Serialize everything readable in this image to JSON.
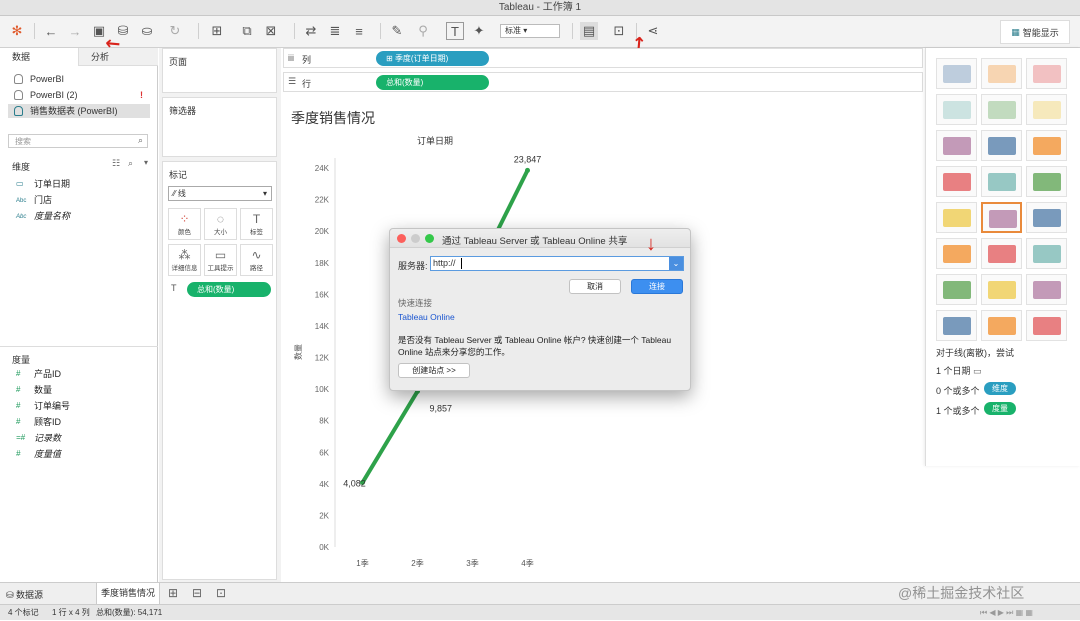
{
  "window": {
    "title": "Tableau - 工作簿 1"
  },
  "toolbar": {
    "mark_size_select": "标准",
    "smart_show_label": "智能显示"
  },
  "left_pane": {
    "tabs": [
      "数据",
      "分析"
    ],
    "datasources": [
      "PowerBI",
      "PowerBI (2)",
      "销售数据表 (PowerBI)"
    ],
    "search_placeholder": "搜索",
    "dimensions_title": "维度",
    "dimensions": [
      {
        "icon": "calendar-icon",
        "label": "订单日期"
      },
      {
        "icon": "Abc",
        "label": "门店"
      },
      {
        "icon": "Abc",
        "label": "度量名称"
      }
    ],
    "measures_title": "度量",
    "measures": [
      "产品ID",
      "数量",
      "订单编号",
      "顾客ID",
      "记录数",
      "度量值"
    ]
  },
  "cards": {
    "pages": "页面",
    "filters": "筛选器",
    "marks": "标记",
    "mark_type": "线",
    "mark_buttons": [
      "颜色",
      "大小",
      "标签",
      "详细信息",
      "工具提示",
      "路径"
    ],
    "mark_pill": "总和(数量)"
  },
  "shelves": {
    "columns_label": "列",
    "columns_pill": "季度(订单日期)",
    "rows_label": "行",
    "rows_pill": "总和(数量)"
  },
  "view": {
    "title": "季度销售情况"
  },
  "chart_data": {
    "type": "line",
    "title": "订单日期",
    "categories": [
      "1季",
      "2季",
      "3季",
      "4季"
    ],
    "values": [
      4082,
      9857,
      null,
      23847
    ],
    "labels": [
      "4,082",
      "9,857",
      "",
      "23,847"
    ],
    "ylabel": "数量",
    "yticks": [
      "0K",
      "2K",
      "4K",
      "6K",
      "8K",
      "10K",
      "12K",
      "14K",
      "16K",
      "18K",
      "20K",
      "22K",
      "24K"
    ],
    "ylim": [
      0,
      24000
    ],
    "color": "#2ea24a"
  },
  "dialog": {
    "title": "通过 Tableau Server 或 Tableau Online 共享",
    "server_label": "服务器:",
    "server_value": "http://",
    "cancel": "取消",
    "connect": "连接",
    "quick_title": "快速连接",
    "quick_link": "Tableau Online",
    "note": "是否没有 Tableau Server 或 Tableau Online 帐户? 快速创建一个 Tableau Online 站点来分享您的工作。",
    "create_site": "创建站点 >>"
  },
  "show_me": {
    "hint_title": "对于线(离散)，尝试",
    "hints": [
      {
        "text": "1 个日期",
        "pill": ""
      },
      {
        "text": "0 个或多个",
        "pill": "维度"
      },
      {
        "text": "1 个或多个",
        "pill": "度量"
      }
    ]
  },
  "bottom": {
    "tabs": [
      "数据源",
      "季度销售情况"
    ]
  },
  "status": {
    "marks": "4 个标记",
    "rows_cols": "1 行 x 4 列",
    "sum": "总和(数量): 54,171"
  },
  "watermark": "@稀土掘金技术社区"
}
